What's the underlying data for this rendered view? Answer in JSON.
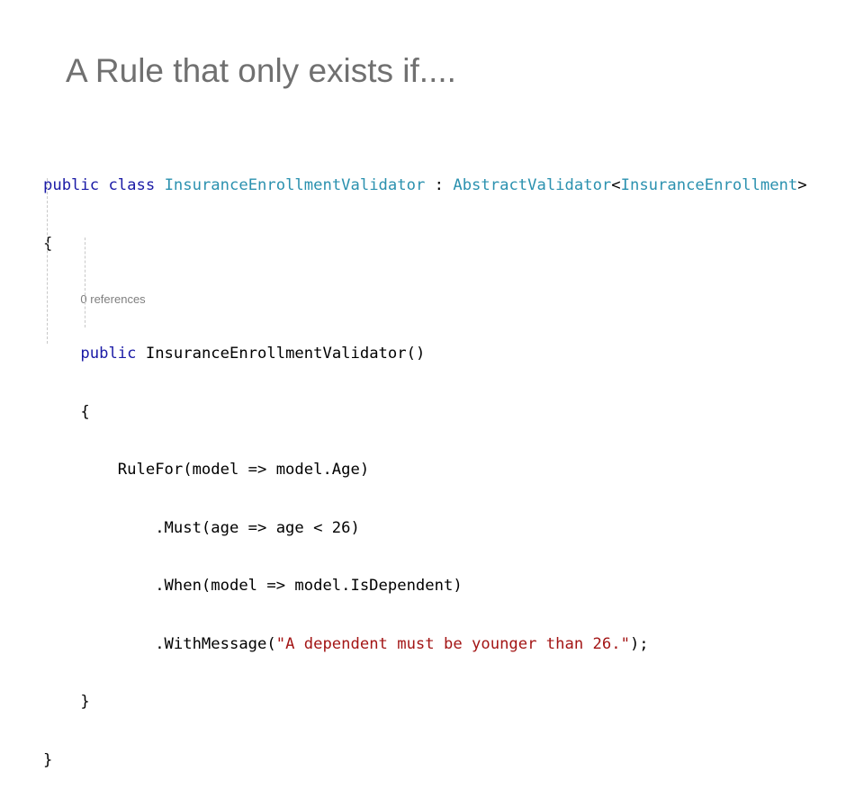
{
  "slide": {
    "title": "A Rule that only exists if...."
  },
  "code": {
    "class_decl": {
      "kw_public": "public",
      "kw_class": "class",
      "class_name": "InsuranceEnrollmentValidator",
      "colon": " : ",
      "base_type": "AbstractValidator",
      "lt": "<",
      "generic_arg": "InsuranceEnrollment",
      "gt": ">"
    },
    "open_brace_class": "{",
    "code_lens": "0 references",
    "ctor_decl": {
      "kw_public": "public",
      "name": "InsuranceEnrollmentValidator()"
    },
    "open_brace_ctor": "{",
    "rule_for": "RuleFor(model => model.Age)",
    "must": ".Must(age => age < 26)",
    "when": ".When(model => model.IsDependent)",
    "with_message_prefix": ".WithMessage(",
    "with_message_string": "\"A dependent must be younger than 26.\"",
    "with_message_suffix": ");",
    "close_brace_ctor": "}",
    "close_brace_class": "}"
  },
  "colors": {
    "keyword": "#1a1aa6",
    "type": "#2b91af",
    "string": "#a31515",
    "title": "#707070",
    "code_lens": "#7f7f7f"
  }
}
